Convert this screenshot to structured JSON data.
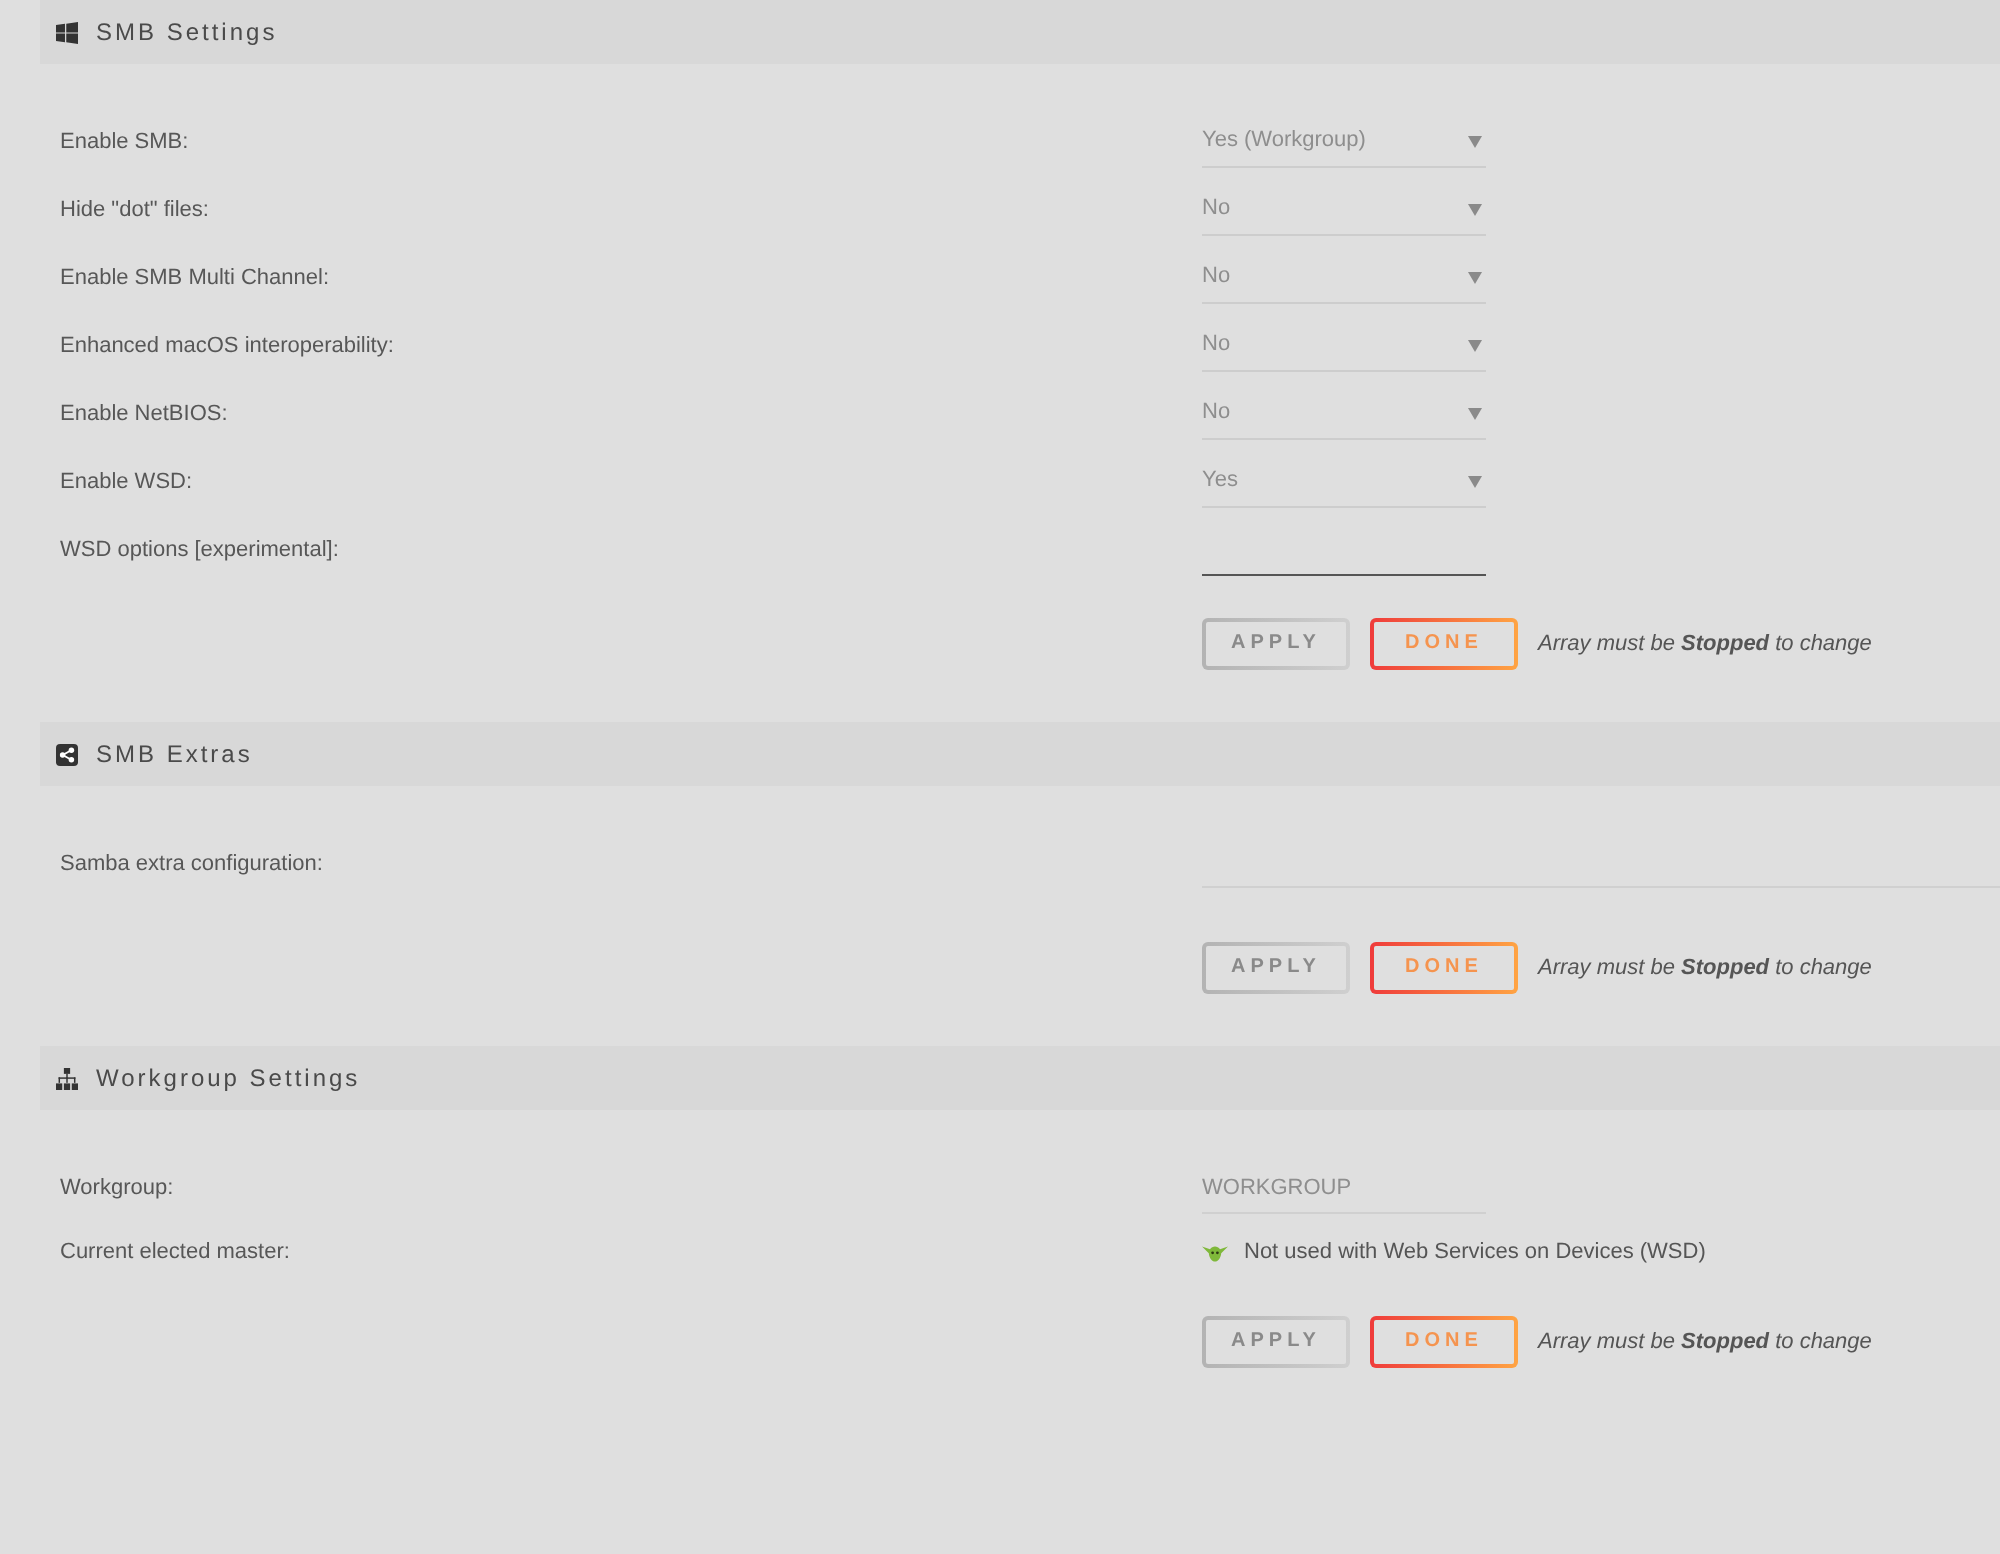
{
  "sections": [
    {
      "title": "SMB Settings",
      "fields": [
        {
          "kind": "select",
          "label": "Enable SMB:",
          "value": "Yes (Workgroup)",
          "disabled": true
        },
        {
          "kind": "select",
          "label": "Hide \"dot\" files:",
          "value": "No",
          "disabled": true
        },
        {
          "kind": "select",
          "label": "Enable SMB Multi Channel:",
          "value": "No",
          "disabled": true
        },
        {
          "kind": "select",
          "label": "Enhanced macOS interoperability:",
          "value": "No",
          "disabled": true
        },
        {
          "kind": "select",
          "label": "Enable NetBIOS:",
          "value": "No",
          "disabled": true
        },
        {
          "kind": "select",
          "label": "Enable WSD:",
          "value": "Yes",
          "disabled": true
        },
        {
          "kind": "text",
          "label": "WSD options [experimental]:",
          "disabled": false
        }
      ],
      "buttons": [
        {
          "label": "APPLY",
          "disabled": true
        },
        {
          "label": "DONE",
          "disabled": false
        }
      ],
      "note": "Array must be **Stopped** to change"
    },
    {
      "title": "SMB Extras",
      "fields": [
        {
          "kind": "textarea",
          "label": "Samba extra configuration:",
          "disabled": true
        }
      ],
      "buttons": [
        {
          "label": "APPLY",
          "disabled": true
        },
        {
          "label": "DONE",
          "disabled": false
        }
      ],
      "note": "Array must be **Stopped** to change"
    },
    {
      "title": "Workgroup Settings",
      "fields": [
        {
          "kind": "text",
          "label": "Workgroup:",
          "value": "WORKGROUP",
          "disabled": true
        },
        {
          "kind": "status",
          "label": "Current elected master:",
          "text": "Not used with Web Services on Devices (WSD)"
        }
      ],
      "buttons": [
        {
          "label": "APPLY",
          "disabled": true
        },
        {
          "label": "DONE",
          "disabled": false
        }
      ],
      "note": "Array must be **Stopped** to change"
    }
  ]
}
